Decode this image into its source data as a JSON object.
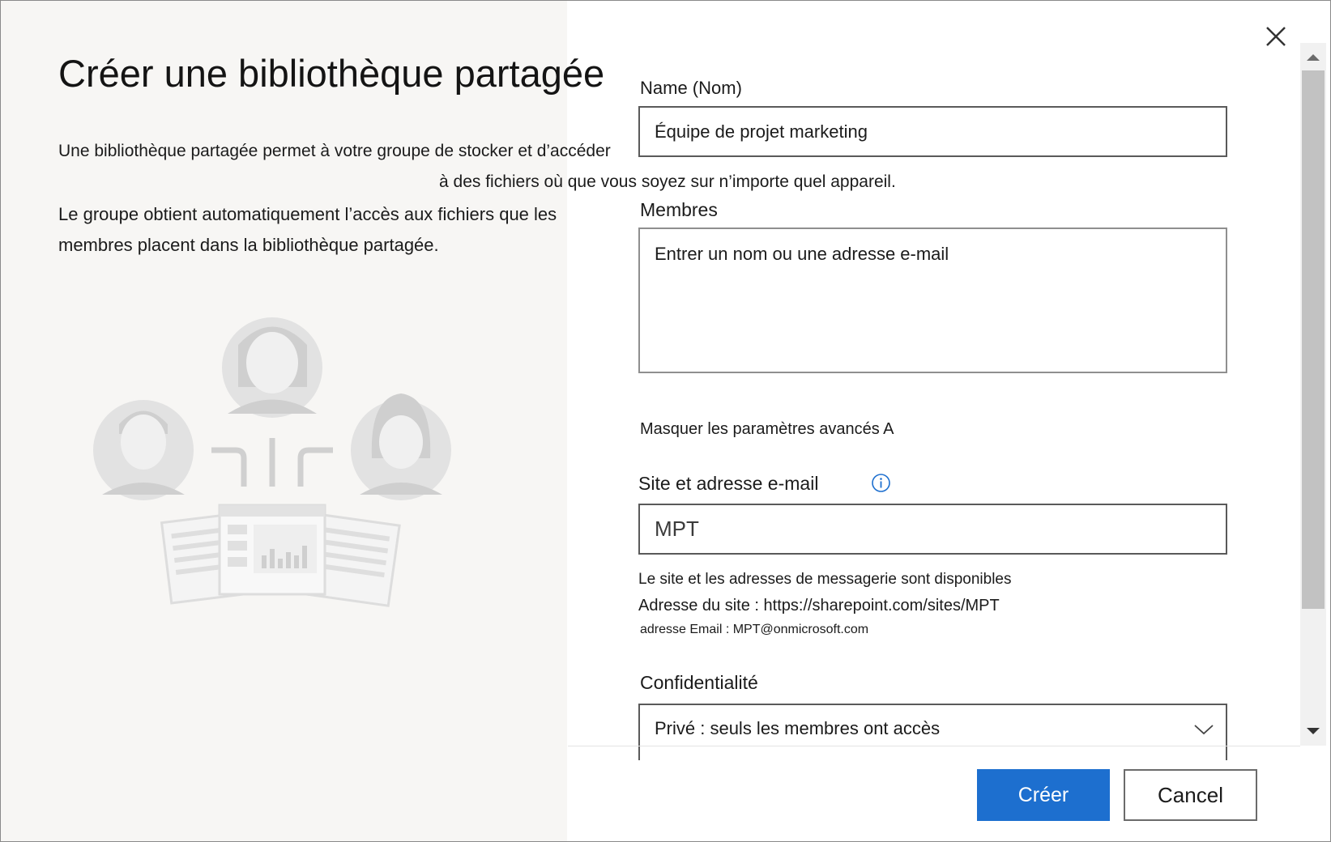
{
  "dialog": {
    "title": "Créer une bibliothèque partagée",
    "intro_line1": "Une bibliothèque partagée permet à votre groupe de stocker et d’accéder",
    "intro_line2": "à des fichiers où que vous soyez sur n’importe quel appareil.",
    "intro_paragraph2": "Le groupe obtient automatiquement l’accès aux fichiers que les membres placent dans la bibliothèque partagée."
  },
  "form": {
    "name_label": "Name (Nom)",
    "name_value": "Équipe de projet marketing",
    "members_label": "Membres",
    "members_placeholder": "Entrer un nom ou une adresse e-mail",
    "advanced_toggle": "Masquer les paramètres avancés A",
    "site_label": "Site et adresse e-mail",
    "site_value": "MPT",
    "availability": "Le site et les adresses de messagerie sont disponibles",
    "site_address": "Adresse du site : https://sharepoint.com/sites/MPT",
    "email_address": "adresse Email : MPT@onmicrosoft.com",
    "privacy_label": "Confidentialité",
    "privacy_value": "Privé : seuls les membres ont accès"
  },
  "footer": {
    "create_label": "Créer",
    "cancel_label": "Cancel"
  },
  "colors": {
    "primary": "#1d6fcf",
    "left_pane": "#f7f6f4",
    "info_icon": "#1d6fcf"
  },
  "icons": [
    "close-icon",
    "info-icon",
    "chevron-down-icon",
    "scroll-up-arrow-icon",
    "scroll-down-arrow-icon"
  ]
}
